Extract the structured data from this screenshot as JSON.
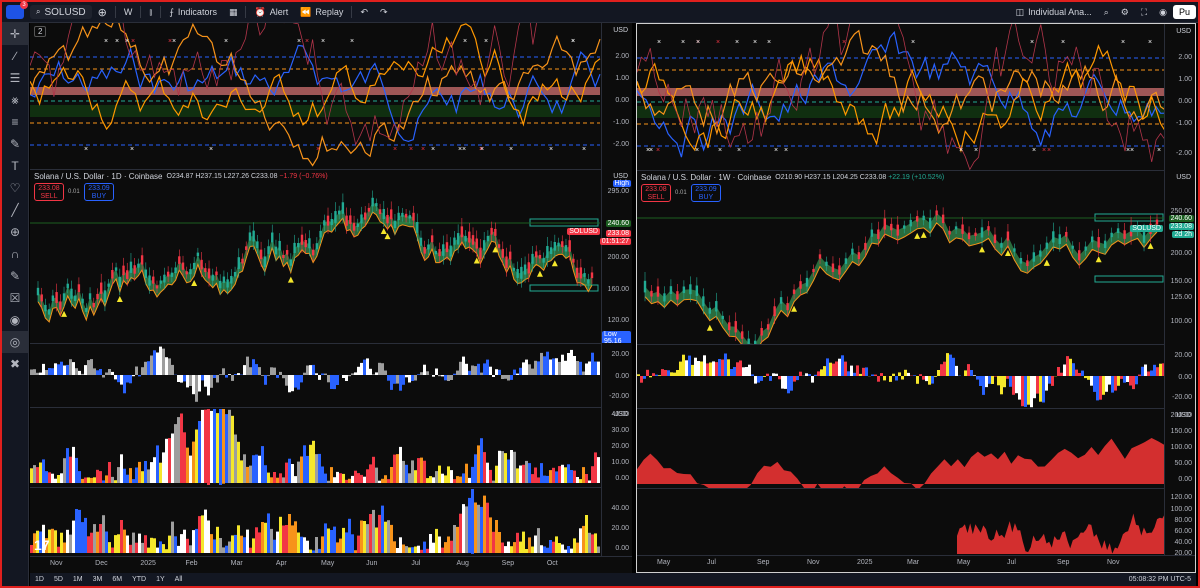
{
  "topbar": {
    "notification_count": "3",
    "symbol": "SOLUSD",
    "interval": "W",
    "indicators_label": "Indicators",
    "alert_label": "Alert",
    "replay_label": "Replay",
    "layout_label": "Individual Ana...",
    "publish_label": "Pu"
  },
  "bottombar": {
    "ranges": [
      "1D",
      "5D",
      "1M",
      "3M",
      "6M",
      "YTD",
      "1Y",
      "All"
    ],
    "clock": "05:08:32 PM UTC-5"
  },
  "left": {
    "osc_badge": "2",
    "osc_ticks": [
      "2.00",
      "1.00",
      "0.00",
      "-1.00",
      "-2.00"
    ],
    "title": "Solana / U.S. Dollar · 1D · Coinbase",
    "ohlc": {
      "o": "O234.87",
      "h": "H237.15",
      "l": "L227.26",
      "c": "C233.08",
      "chg": "−1.79 (−0.76%)"
    },
    "sell_price": "233.08",
    "sell_label": "SELL",
    "spread": "0.01",
    "buy_price": "233.09",
    "buy_label": "BUY",
    "price_ticks": [
      "295.00",
      "240.00",
      "200.00",
      "160.00",
      "120.00"
    ],
    "high_label": "High",
    "high_value": "295.00",
    "low_label": "Low",
    "low_value": "95.16",
    "level_240": "240.60",
    "sym_tag": "SOLUSD",
    "last_price": "233.08",
    "countdown": "01:51:27",
    "sub1_ticks": [
      "20.00",
      "0.00",
      "-20.00"
    ],
    "sub2_ticks": [
      "40.00",
      "30.00",
      "20.00",
      "10.00",
      "0.00"
    ],
    "sub3_ticks": [
      "40.00",
      "20.00",
      "0.00"
    ],
    "months": [
      "Nov",
      "Dec",
      "2025",
      "Feb",
      "Mar",
      "Apr",
      "May",
      "Jun",
      "Jul",
      "Aug",
      "Sep",
      "Oct"
    ]
  },
  "right": {
    "osc_ticks": [
      "2.00",
      "1.00",
      "0.00",
      "-1.00",
      "-2.00"
    ],
    "title": "Solana / U.S. Dollar · 1W · Coinbase",
    "ohlc": {
      "o": "O210.90",
      "h": "H237.15",
      "l": "L204.25",
      "c": "C233.08",
      "chg": "+22.19 (+10.52%)"
    },
    "sell_price": "233.08",
    "sell_label": "SELL",
    "spread": "0.01",
    "buy_price": "233.09",
    "buy_label": "BUY",
    "price_ticks": [
      "250.00",
      "200.00",
      "150.00",
      "125.00",
      "100.00"
    ],
    "level_240": "240.60",
    "sym_tag": "SOLUSD",
    "last_price": "233.08",
    "countdown": "2d 2h",
    "sub1_ticks": [
      "20.00",
      "0.00",
      "-20.00"
    ],
    "sub2_ticks": [
      "200.00",
      "150.00",
      "100.00",
      "50.00",
      "0.00"
    ],
    "sub3_ticks": [
      "120.00",
      "100.00",
      "80.00",
      "60.00",
      "40.00",
      "20.00"
    ],
    "months": [
      "May",
      "Jul",
      "Sep",
      "Nov",
      "2025",
      "Mar",
      "May",
      "Jul",
      "Sep",
      "Nov"
    ]
  },
  "colors": {
    "red": "#f23645",
    "green": "#22ab94",
    "blue": "#2962ff",
    "yellow": "#f5e72b",
    "orange": "#f7931a",
    "accent": "#e0201e"
  }
}
